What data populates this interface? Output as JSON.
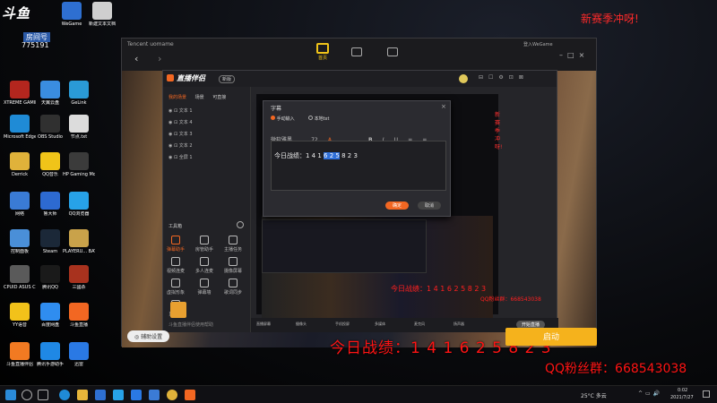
{
  "desktop": {
    "logo": "斗鱼",
    "room_label": "房间号",
    "room_number": "775191",
    "header_overlay": "新赛季冲呀!",
    "icons": [
      {
        "label": "WeGame",
        "color": "#2e6fd1"
      },
      {
        "label": "新建文本文档",
        "color": "#cfcfcf"
      },
      {
        "label": "XTREME GAMIN...",
        "color": "#b3261e"
      },
      {
        "label": "天翼云盘",
        "color": "#3a8de0"
      },
      {
        "label": "GeLink",
        "color": "#2a9ad6"
      },
      {
        "label": "Microsoft Edge",
        "color": "#1f8bd6"
      },
      {
        "label": "OBS Studio",
        "color": "#303030"
      },
      {
        "label": "节点.txt",
        "color": "#dcdcdc"
      },
      {
        "label": "Derrick",
        "color": "#e0b23a"
      },
      {
        "label": "QQ音乐",
        "color": "#f0c419"
      },
      {
        "label": "HP Gaming Mouse G...",
        "color": "#3b3b3b"
      },
      {
        "label": "网络",
        "color": "#3a7bd5"
      },
      {
        "label": "鲁大师",
        "color": "#2d6ad1"
      },
      {
        "label": "QQ浏览器",
        "color": "#27a2e8"
      },
      {
        "label": "控制面板",
        "color": "#4a8fd8"
      },
      {
        "label": "Steam",
        "color": "#1b2838"
      },
      {
        "label": "PLAYERU... BATTLEGR...",
        "color": "#c9a24a"
      },
      {
        "label": "CPUID ASUS CPU-Z",
        "color": "#5a5a5a"
      },
      {
        "label": "腾讯QQ",
        "color": "#1a1a1a"
      },
      {
        "label": "三國杀",
        "color": "#a8321e"
      },
      {
        "label": "YY语音",
        "color": "#f2c21a"
      },
      {
        "label": "百度网盘",
        "color": "#2f8df0"
      },
      {
        "label": "斗鱼直播",
        "color": "#f26722"
      },
      {
        "label": "斗鱼直播伴侣",
        "color": "#f27a22"
      },
      {
        "label": "腾讯手游助手",
        "color": "#1f88e5"
      },
      {
        "label": "迅雷",
        "color": "#2a79e4"
      }
    ]
  },
  "window": {
    "title": "Tencent uomame",
    "home_label": "首页",
    "user": "登入WeGame"
  },
  "app": {
    "name": "直播伴侣",
    "badge": "新版",
    "tabs": [
      "我的场景",
      "场景",
      "可直接"
    ],
    "scenes": [
      "文本 1",
      "文本 4",
      "文本 3",
      "文本 2",
      "全屏 1"
    ],
    "tools_header": "工具箱",
    "tools": [
      "弹幕助手",
      "房管助手",
      "主播任务",
      "视频连麦",
      "多人连麦",
      "摄像屏幕",
      "虚拟形象",
      "弹幕墙",
      "歌词同步",
      "直播中"
    ],
    "bottom_bar": [
      "直播屏幕",
      "摄像头",
      "手机投屏",
      "多媒体",
      "麦克风",
      "扬声器"
    ],
    "bottom_right": "开始直播",
    "assistant": "辅助设置",
    "status": "斗鱼直播伴侣使用帮助",
    "side_red": "新赛季冲呀!"
  },
  "dialog": {
    "title": "字幕",
    "radio_manual": "手动输入",
    "radio_file": "本地txt",
    "font": "微软雅黑",
    "size": "72",
    "toolbar": [
      "B",
      "I",
      "U"
    ],
    "text_before": "今日战绩：1 4 1 ",
    "text_selected": "6 2 5",
    "text_after": " 8 2 3",
    "ok": "确定",
    "cancel": "取消"
  },
  "preview": {
    "stats_text": "今日战绩：1 4 1 6 2 5 8 2 3",
    "qq_text": "QQ粉丝群：668543038"
  },
  "overlay": {
    "stats": "今日战绩：1 4 1 6 2 5 8 2 3",
    "qq": "QQ粉丝群：668543038",
    "start": "启动"
  },
  "taskbar": {
    "weather": "25°C 多云",
    "time": "0:02",
    "date": "2021/7/27"
  }
}
